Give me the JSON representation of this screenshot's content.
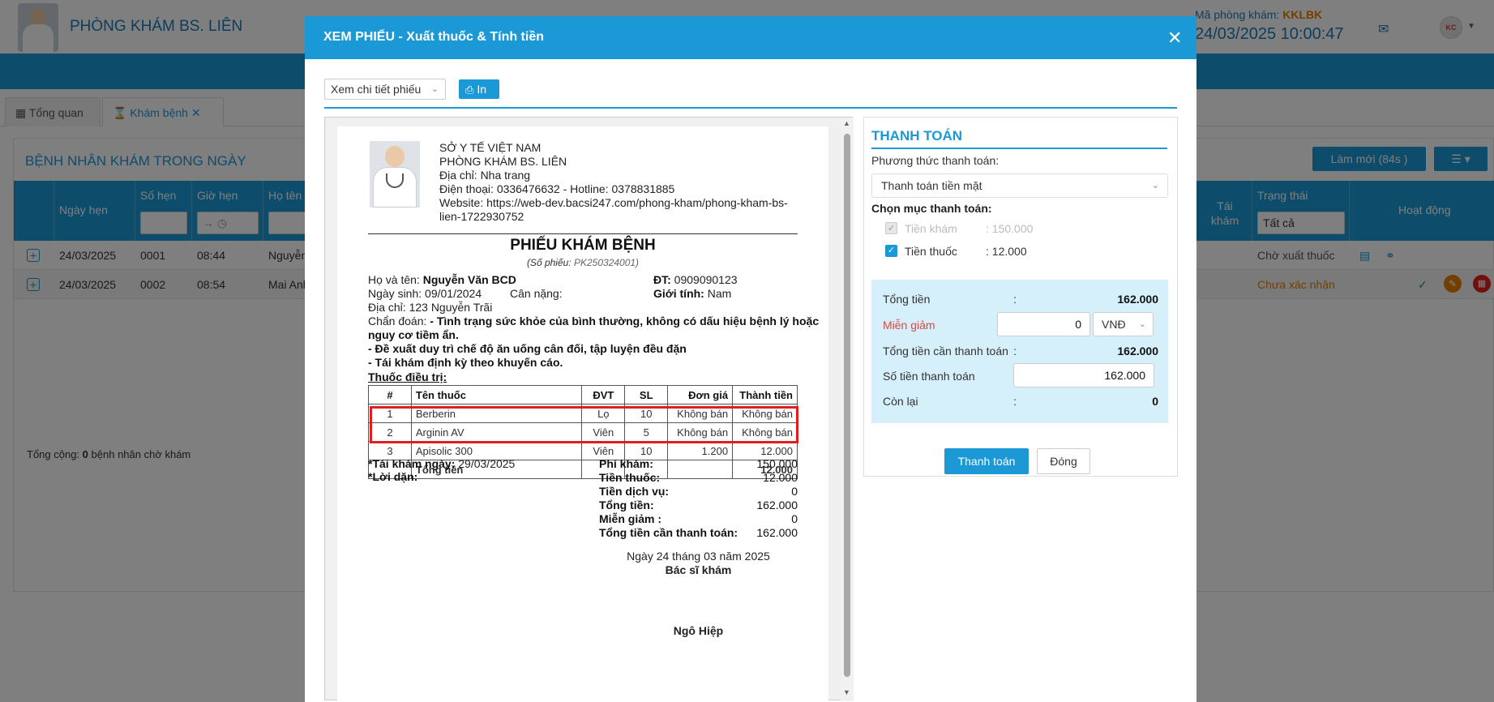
{
  "app": {
    "clinic_name": "PHÒNG KHÁM BS. LIÊN",
    "clinic_code_label": "Mã phòng khám:",
    "clinic_code": "KKLBK",
    "datetime": "24/03/2025 10:00:47",
    "avatar_text": "KC"
  },
  "tabs": [
    {
      "label": "Tổng quan"
    },
    {
      "label": "Khám bệnh"
    }
  ],
  "patients_panel": {
    "title": "BỆNH NHÂN KHÁM TRONG NGÀY",
    "refresh_label": "Làm mới (84s )",
    "columns": {
      "date": "Ngày hẹn",
      "number": "Số hẹn",
      "time": "Giờ hẹn",
      "name": "Họ tên",
      "revisit": "Tái khám",
      "status": "Trạng thái",
      "actions": "Hoạt động"
    },
    "status_filter": "Tất cả",
    "rows": [
      {
        "date": "24/03/2025",
        "number": "0001",
        "time": "08:44",
        "name": "Nguyễn",
        "status": "Chờ xuất thuốc"
      },
      {
        "date": "24/03/2025",
        "number": "0002",
        "time": "08:54",
        "name": "Mai Anh",
        "status": "Chưa xác nhận"
      }
    ],
    "total_prefix": "Tổng cộng:",
    "total_count": "0",
    "total_suffix": "bệnh nhân chờ khám"
  },
  "modal": {
    "title": "XEM PHIẾU - Xuất thuốc & Tính tiền",
    "view_select": "Xem chi tiết phiếu",
    "print_label": "In"
  },
  "receipt": {
    "header": {
      "dept": "SỞ Y TẾ VIỆT NAM",
      "clinic": "PHÒNG KHÁM BS. LIÊN",
      "address": "Địa chỉ: Nha trang",
      "phone": "Điện thoại: 0336476632 - Hotline: 0378831885",
      "website_1": "Website: https://web-dev.bacsi247.com/phong-kham/phong-kham-bs-",
      "website_2": "lien-1722930752"
    },
    "title": "PHIẾU KHÁM BỆNH",
    "receipt_no_label": "(Số phiếu:",
    "receipt_no": "PK250324001)",
    "patient": {
      "name_label": "Họ và tên:",
      "name": "Nguyễn Văn BCD",
      "phone_label": "ĐT:",
      "phone": "0909090123",
      "dob_label": "Ngày sinh:",
      "dob": "09/01/2024",
      "weight_label": "Cân nặng:",
      "gender_label": "Giới tính:",
      "gender": "Nam",
      "address_label": "Địa chỉ:",
      "address": "123 Nguyễn Trãi",
      "diagnosis_label": "Chẩn đoán:",
      "diagnosis_1": "- Tình trạng sức khỏe của bình thường, không có dấu hiệu bệnh lý hoặc",
      "diagnosis_2": "nguy cơ tiềm ẩn.",
      "diagnosis_3": "- Đề xuất duy trì chế độ ăn uống cân đối, tập luyện đều đặn",
      "diagnosis_4": "- Tái khám định kỳ theo khuyến cáo."
    },
    "med_title": "Thuốc điều trị:",
    "med_cols": {
      "no": "#",
      "name": "Tên thuốc",
      "unit": "ĐVT",
      "qty": "SL",
      "price": "Đơn giá",
      "amount": "Thành tiền"
    },
    "meds": [
      {
        "no": "1",
        "name": "Berberin",
        "unit": "Lọ",
        "qty": "10",
        "price": "Không bán",
        "amount": "Không bán"
      },
      {
        "no": "2",
        "name": "Arginin AV",
        "unit": "Viên",
        "qty": "5",
        "price": "Không bán",
        "amount": "Không bán"
      },
      {
        "no": "3",
        "name": "Apisolic 300",
        "unit": "Viên",
        "qty": "10",
        "price": "1.200",
        "amount": "12.000"
      }
    ],
    "med_total_label": "Tổng tiền",
    "med_total": "12.000",
    "revisit_label": "*Tái khám ngày:",
    "revisit_date": "29/03/2025",
    "advice_label": "*Lời dặn:",
    "summary": [
      {
        "label": "Phí khám:",
        "value": "150.000"
      },
      {
        "label": "Tiền thuốc:",
        "value": "12.000"
      },
      {
        "label": "Tiền dịch vụ:",
        "value": "0"
      },
      {
        "label": "Tổng tiền:",
        "value": "162.000"
      },
      {
        "label": "Miễn giảm :",
        "value": "0"
      },
      {
        "label": "Tổng tiền cần thanh toán:",
        "value": "162.000"
      }
    ],
    "sign_date": "Ngày 24 tháng 03 năm 2025",
    "sign_title": "Bác sĩ khám",
    "doctor_name": "Ngô Hiệp"
  },
  "payment": {
    "title": "THANH TOÁN",
    "method_label": "Phương thức thanh toán:",
    "method": "Thanh toán tiền mặt",
    "items_label": "Chọn mục thanh toán:",
    "item_exam": "Tiền khám",
    "item_exam_value": ": 150.000",
    "item_med": "Tiền thuốc",
    "item_med_value": ": 12.000",
    "total_label": "Tổng tiền",
    "total": "162.000",
    "discount_label": "Miễn giảm",
    "discount": "0",
    "discount_unit": "VNĐ",
    "due_label": "Tổng tiền cần thanh toán",
    "due": "162.000",
    "paid_label": "Số tiền thanh toán",
    "paid": "162.000",
    "remain_label": "Còn lại",
    "remain": "0",
    "colon": ":",
    "pay_button": "Thanh toán",
    "close_button": "Đóng"
  },
  "colors": {
    "primary": "#1a99d6",
    "accent": "#e67e00",
    "highlight": "#e01e1e"
  }
}
